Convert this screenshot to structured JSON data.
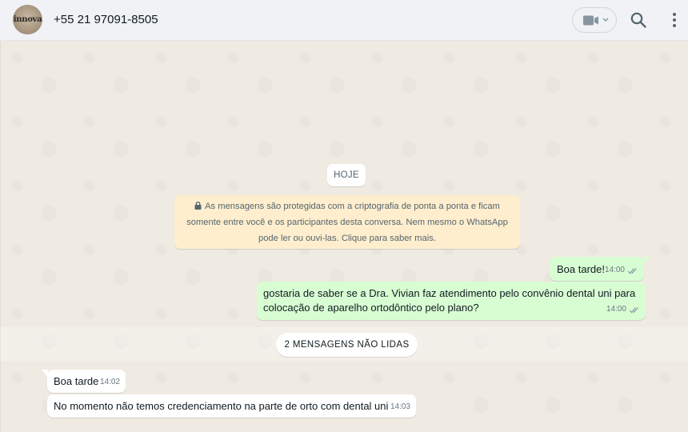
{
  "header": {
    "avatar_logo_text": "innova",
    "contact_name": "+55 21 97091-8505",
    "icons": [
      "video-camera-icon",
      "chevron-down-icon",
      "search-icon",
      "menu-dots-icon"
    ]
  },
  "chat": {
    "date_chip": "HOJE",
    "encryption_notice": "As mensagens são protegidas com a criptografia de ponta a ponta e ficam somente entre você e os participantes desta conversa. Nem mesmo o WhatsApp pode ler ou ouvi-las. Clique para saber mais.",
    "outgoing": [
      {
        "text": "Boa tarde!",
        "time": "14:00",
        "status": "read"
      },
      {
        "text": "gostaria de saber se a Dra. Vivian faz atendimento pelo convênio dental uni para colocação de aparelho ortodôntico pelo plano?",
        "time": "14:00",
        "status": "read"
      }
    ],
    "unread_label": "2 MENSAGENS NÃO LIDAS",
    "incoming": [
      {
        "text": "Boa tarde",
        "time": "14:02"
      },
      {
        "text": "No momento não temos credenciamento na parte de orto com dental uni",
        "time": "14:03"
      }
    ]
  },
  "colors": {
    "header_bg": "#f0f2f5",
    "chat_bg": "#efeae2",
    "outgoing_bubble": "#d9fdd3",
    "incoming_bubble": "#ffffff",
    "notice_bg": "#ffeecd",
    "read_ticks": "#53bdeb"
  }
}
